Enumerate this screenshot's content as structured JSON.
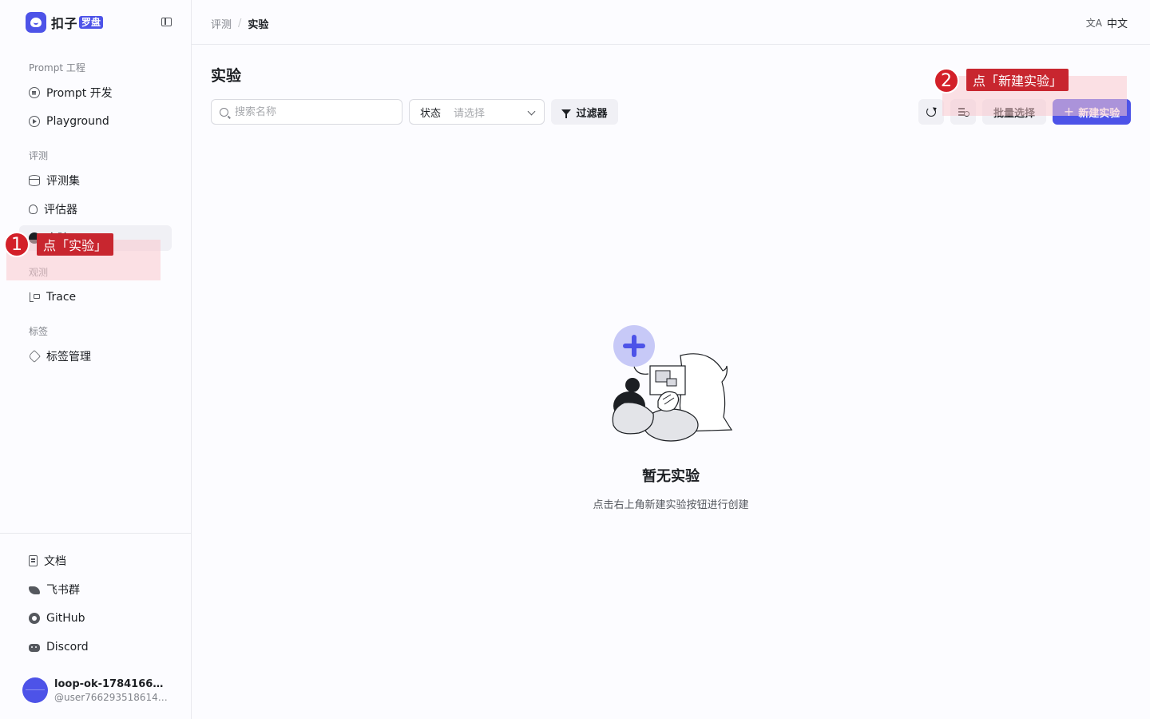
{
  "app": {
    "logo_text": "扣子",
    "logo_tag": "罗盘"
  },
  "sidebar": {
    "groups": [
      {
        "title": "Prompt 工程",
        "items": [
          "Prompt 开发",
          "Playground"
        ]
      },
      {
        "title": "评测",
        "items": [
          "评测集",
          "评估器",
          "实验"
        ]
      },
      {
        "title": "观测",
        "items": [
          "Trace"
        ]
      },
      {
        "title": "标签",
        "items": [
          "标签管理"
        ]
      }
    ],
    "footer_items": [
      "文档",
      "飞书群",
      "GitHub",
      "Discord"
    ],
    "user": {
      "name": "loop-ok-1784166128…",
      "handle": "@user76629351861447…"
    }
  },
  "header": {
    "breadcrumb": [
      "评测",
      "实验"
    ],
    "language": "中文",
    "language_icon": "文A"
  },
  "main": {
    "title": "实验",
    "search_placeholder": "搜索名称",
    "status_label": "状态",
    "status_placeholder": "请选择",
    "filter_label": "过滤器",
    "batch_select_label": "批量选择",
    "new_experiment_label": "新建实验",
    "plus_glyph": "+",
    "empty_title": "暂无实验",
    "empty_desc": "点击右上角新建实验按钮进行创建"
  },
  "annotations": [
    {
      "num": "1",
      "text": "点「实验」"
    },
    {
      "num": "2",
      "text": "点「新建实验」"
    }
  ],
  "colors": {
    "accent": "#4d53e8",
    "annotation": "#c8262f"
  }
}
